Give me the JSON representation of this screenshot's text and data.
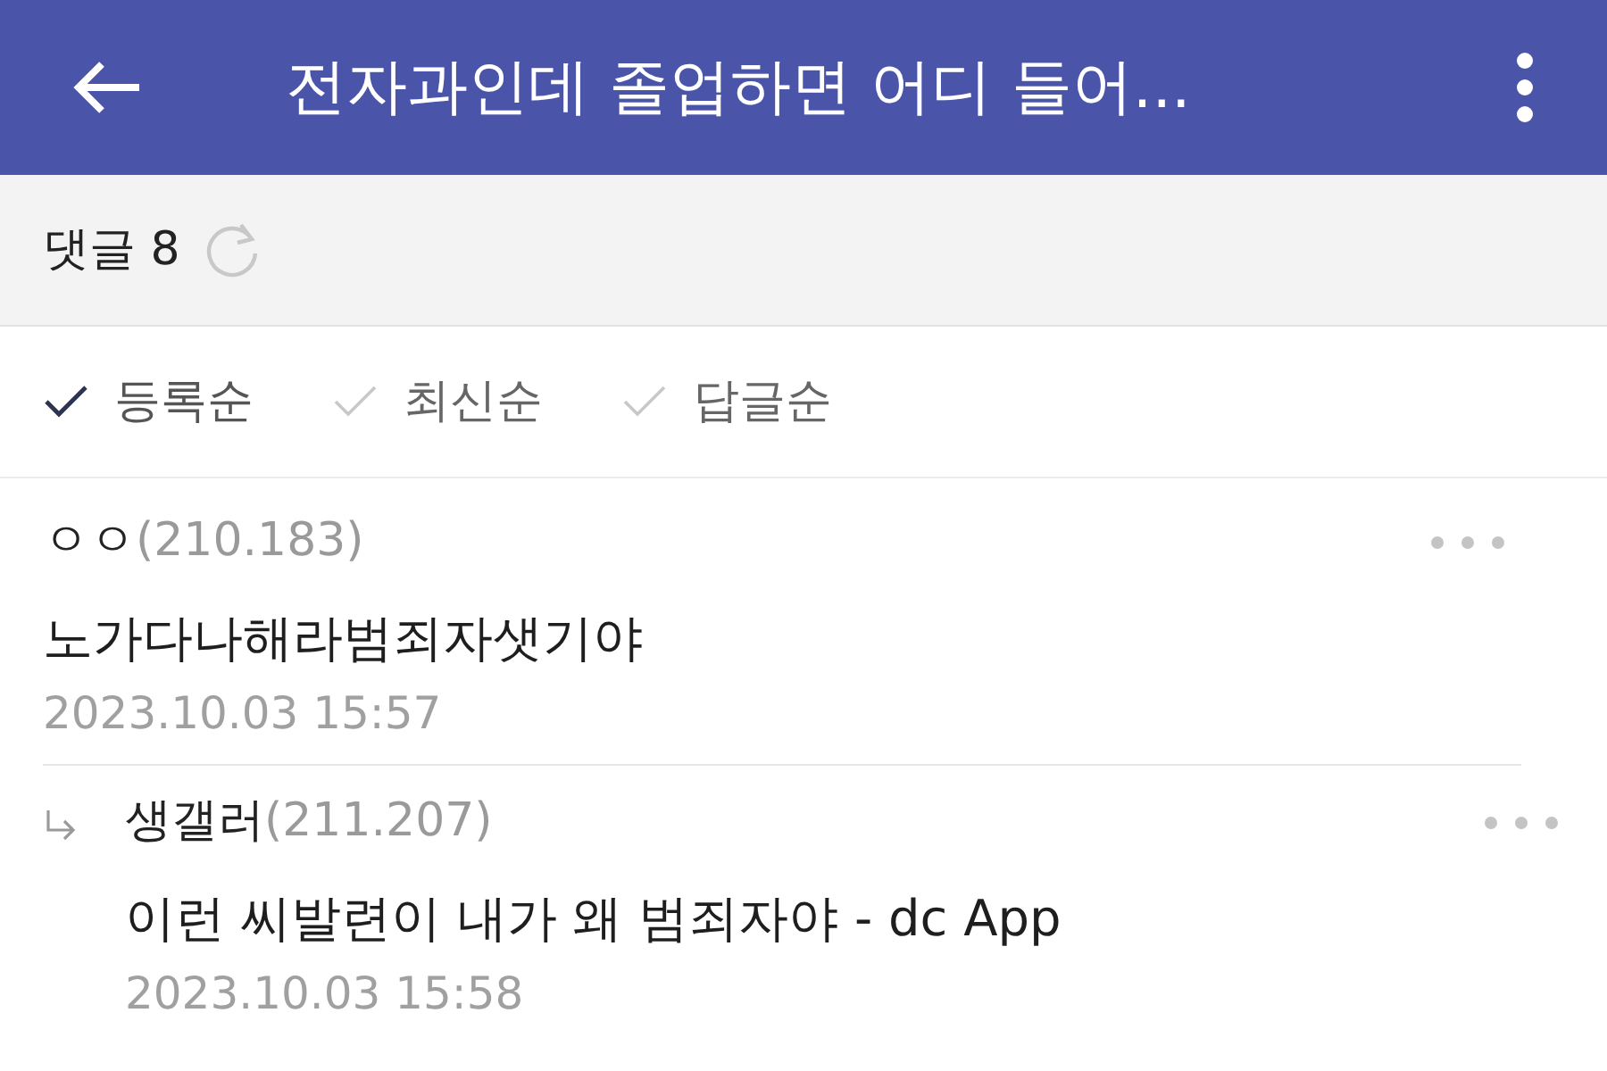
{
  "header": {
    "title": "전자과인데 졸업하면 어디 들어..."
  },
  "comment_bar": {
    "label": "댓글 8"
  },
  "sort_options": [
    {
      "label": "등록순",
      "selected": true
    },
    {
      "label": "최신순",
      "selected": false
    },
    {
      "label": "답글순",
      "selected": false
    }
  ],
  "comments": [
    {
      "kind": "comment",
      "author": "ㅇㅇ",
      "ip": "(210.183)",
      "text": "노가다나해라범죄자샛기야",
      "time": "2023.10.03 15:57"
    },
    {
      "kind": "reply",
      "author": "생갤러",
      "ip": "(211.207)",
      "text": "이런 씨발련이 내가 왜 범죄자야 - dc App",
      "time": "2023.10.03 15:58"
    }
  ]
}
